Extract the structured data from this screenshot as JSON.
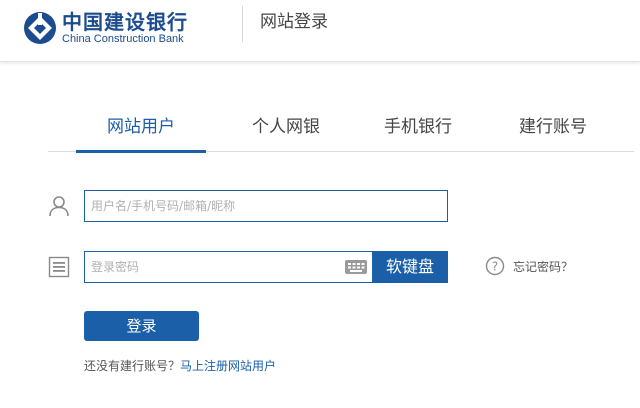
{
  "header": {
    "logo_cn": "中国建设银行",
    "logo_en": "China Construction Bank",
    "page_title": "网站登录",
    "brand_color": "#1c4c8f"
  },
  "tabs": [
    {
      "label": "网站用户",
      "active": true
    },
    {
      "label": "个人网银",
      "active": false
    },
    {
      "label": "手机银行",
      "active": false
    },
    {
      "label": "建行账号",
      "active": false
    }
  ],
  "form": {
    "username_placeholder": "用户名/手机号码/邮箱/昵称",
    "username_value": "",
    "password_placeholder": "登录密码",
    "password_value": "",
    "soft_keyboard_label": "软键盘",
    "forgot_password_label": "忘记密码？",
    "login_label": "登录"
  },
  "register": {
    "prompt": "还没有建行账号？",
    "link": "马上注册网站用户"
  },
  "colors": {
    "accent": "#1a5fa8"
  },
  "icons": {
    "user": "user-icon",
    "password": "password-icon",
    "keyboard": "keyboard-icon",
    "help": "help-icon"
  }
}
